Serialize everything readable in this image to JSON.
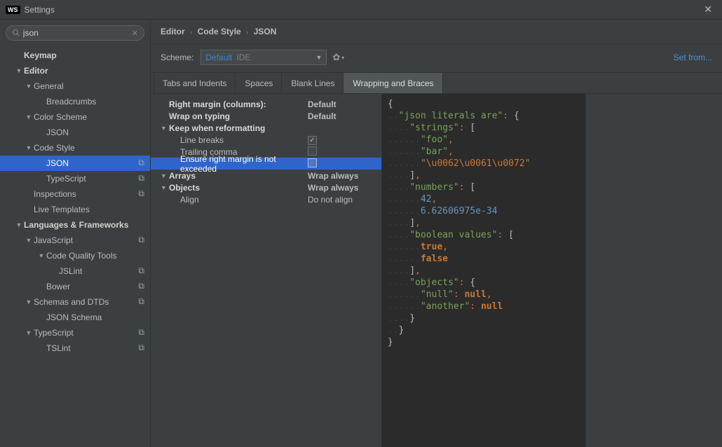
{
  "window": {
    "title": "Settings",
    "badge": "WS"
  },
  "search": {
    "value": "json",
    "clear": "✕"
  },
  "tree": [
    {
      "label": "Keymap",
      "indent": 0,
      "arrow": "",
      "bold": true
    },
    {
      "label": "Editor",
      "indent": 0,
      "arrow": "▼",
      "bold": true
    },
    {
      "label": "General",
      "indent": 1,
      "arrow": "▼",
      "bold": false
    },
    {
      "label": "Breadcrumbs",
      "indent": 2,
      "arrow": "",
      "bold": false
    },
    {
      "label": "Color Scheme",
      "indent": 1,
      "arrow": "▼",
      "bold": false
    },
    {
      "label": "JSON",
      "indent": 2,
      "arrow": "",
      "bold": false
    },
    {
      "label": "Code Style",
      "indent": 1,
      "arrow": "▼",
      "bold": false
    },
    {
      "label": "JSON",
      "indent": 2,
      "arrow": "",
      "bold": false,
      "active": true,
      "tail": "⧉"
    },
    {
      "label": "TypeScript",
      "indent": 2,
      "arrow": "",
      "bold": false,
      "tail": "⧉"
    },
    {
      "label": "Inspections",
      "indent": 1,
      "arrow": "",
      "bold": false,
      "tail": "⧉"
    },
    {
      "label": "Live Templates",
      "indent": 1,
      "arrow": "",
      "bold": false
    },
    {
      "label": "Languages & Frameworks",
      "indent": 0,
      "arrow": "▼",
      "bold": true
    },
    {
      "label": "JavaScript",
      "indent": 1,
      "arrow": "▼",
      "bold": false,
      "tail": "⧉"
    },
    {
      "label": "Code Quality Tools",
      "indent": 2,
      "arrow": "▼",
      "bold": false
    },
    {
      "label": "JSLint",
      "indent": 3,
      "arrow": "",
      "bold": false,
      "tail": "⧉"
    },
    {
      "label": "Bower",
      "indent": 2,
      "arrow": "",
      "bold": false,
      "tail": "⧉"
    },
    {
      "label": "Schemas and DTDs",
      "indent": 1,
      "arrow": "▼",
      "bold": false,
      "tail": "⧉"
    },
    {
      "label": "JSON Schema",
      "indent": 2,
      "arrow": "",
      "bold": false
    },
    {
      "label": "TypeScript",
      "indent": 1,
      "arrow": "▼",
      "bold": false,
      "tail": "⧉"
    },
    {
      "label": "TSLint",
      "indent": 2,
      "arrow": "",
      "bold": false,
      "tail": "⧉"
    }
  ],
  "breadcrumbs": {
    "a": "Editor",
    "b": "Code Style",
    "c": "JSON"
  },
  "scheme": {
    "label": "Scheme:",
    "value": "Default",
    "suffix": "IDE",
    "gear": "✿",
    "setFrom": "Set from..."
  },
  "tabs": [
    {
      "label": "Tabs and Indents",
      "active": false
    },
    {
      "label": "Spaces",
      "active": false
    },
    {
      "label": "Blank Lines",
      "active": false
    },
    {
      "label": "Wrapping and Braces",
      "active": true
    }
  ],
  "options": [
    {
      "name": "Right margin (columns):",
      "value": "Default",
      "kind": "text",
      "bold": true,
      "indent": "a"
    },
    {
      "name": "Wrap on typing",
      "value": "Default",
      "kind": "text",
      "bold": true,
      "indent": "a"
    },
    {
      "name": "Keep when reformatting",
      "value": "",
      "kind": "group",
      "bold": true,
      "indent": "a",
      "caret": "▼"
    },
    {
      "name": "Line breaks",
      "value": "",
      "kind": "checkbox",
      "checked": true,
      "indent": "b"
    },
    {
      "name": "Trailing comma",
      "value": "",
      "kind": "checkbox",
      "checked": false,
      "indent": "b"
    },
    {
      "name": "Ensure right margin is not exceeded",
      "value": "",
      "kind": "checkbox",
      "checked": false,
      "indent": "b",
      "selected": true
    },
    {
      "name": "Arrays",
      "value": "Wrap always",
      "kind": "text",
      "bold": true,
      "indent": "a",
      "caret": "▼"
    },
    {
      "name": "Objects",
      "value": "Wrap always",
      "kind": "text",
      "bold": true,
      "indent": "a",
      "caret": "▼"
    },
    {
      "name": "Align",
      "value": "Do not align",
      "kind": "text",
      "indent": "b"
    }
  ],
  "preview": {
    "d1": "..",
    "d2": "....",
    "d3": "......",
    "k_literals": "\"json literals are\"",
    "k_strings": "\"strings\"",
    "s_foo": "\"foo\"",
    "s_bar": "\"bar\"",
    "s_esc": "\"\\u0062\\u0061\\u0072\"",
    "k_numbers": "\"numbers\"",
    "n_42": "42",
    "n_sci": "6.62606975e-34",
    "k_bool": "\"boolean values\"",
    "kw_true": "true",
    "kw_false": "false",
    "k_objects": "\"objects\"",
    "k_null": "\"null\"",
    "k_another": "\"another\"",
    "kw_null": "null"
  }
}
